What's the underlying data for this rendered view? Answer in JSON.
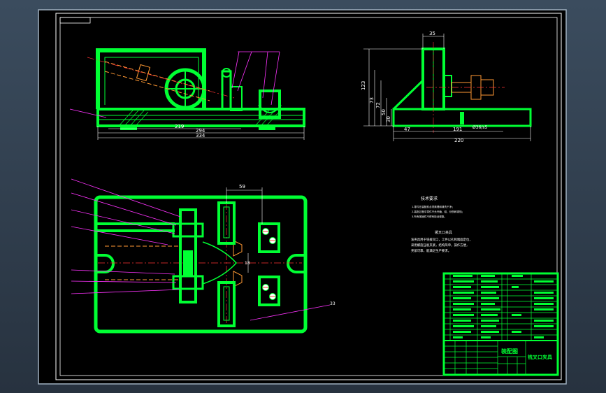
{
  "colors": {
    "background": "#2b3a4a",
    "sheet": "#000000",
    "frame": "#ffffff",
    "part": "#00ff33",
    "hatch": "#00ff33",
    "dimension": "#ffffff",
    "centerline": "#ff3333",
    "leader": "#ff33ff",
    "note_text": "#ffffff",
    "title_block": "#00ff33"
  },
  "front_view": {
    "dim_219": "219",
    "dim_294": "294",
    "dim_334": "334"
  },
  "side_view": {
    "dim_35": "35",
    "dim_123": "123",
    "dim_73": "73",
    "dim_72": "72",
    "dim_50": "50",
    "dim_30": "30",
    "dim_47": "47",
    "dim_191": "191",
    "dim_220": "220",
    "dim_phi": "Ø36/s5"
  },
  "plan_view": {
    "dim_59": "59",
    "dim_18": "18",
    "balloon_33": "33"
  },
  "technical_notes": {
    "heading": "技术要求",
    "line1": "1.零件在装配前必须清理和清洗干净；",
    "line2": "2.装配过程中零件不允许磕、碰、划伤和锈蚀；",
    "line3": "3.所有紧固件不得有松动现象。",
    "part_title": "拨叉口夹具",
    "desc1": "该夹具用于铣拨叉口，工件以孔和端面定位，",
    "desc2": "采用螺旋压板夹紧，结构简单，操作方便，",
    "desc3": "夹紧可靠，能满足生产要求。"
  },
  "title_block": {
    "drawing_type": "装配图",
    "drawing_name": "铣叉口夹具"
  }
}
